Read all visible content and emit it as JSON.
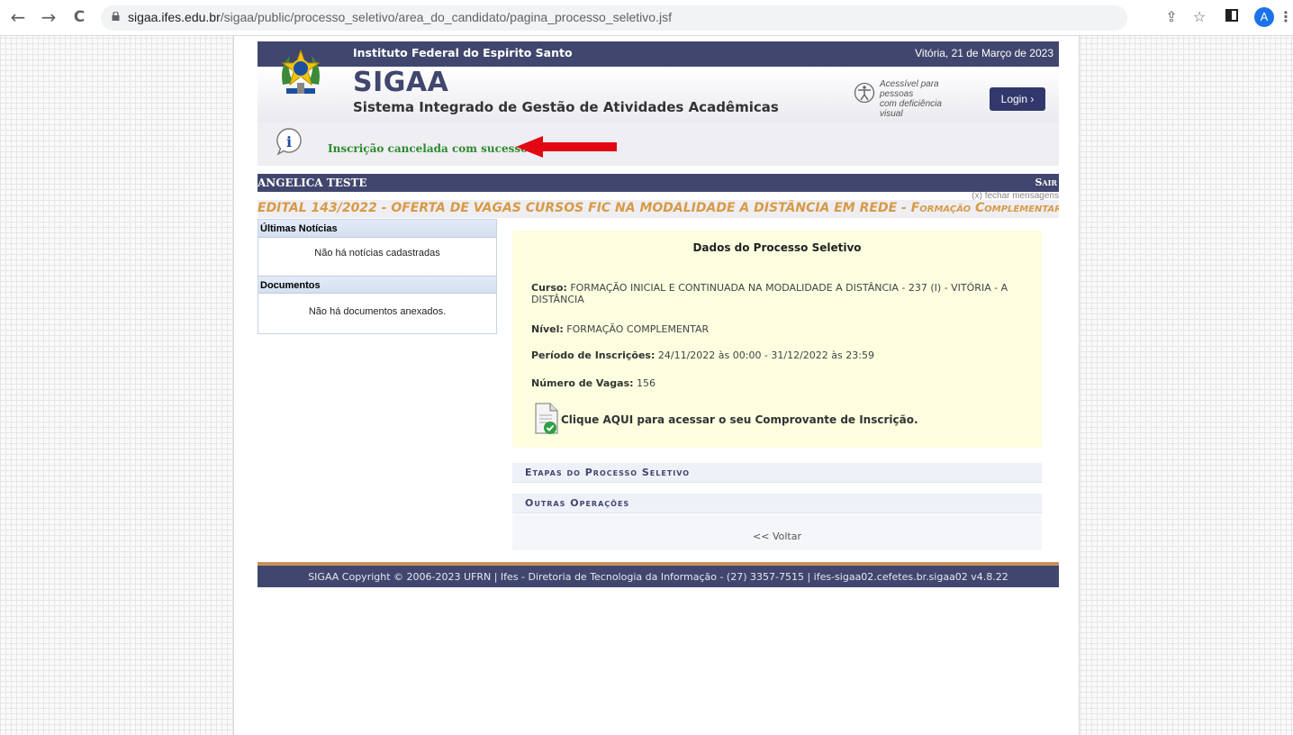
{
  "browser": {
    "back": "←",
    "forward": "→",
    "reload": "C",
    "url_host": "sigaa.ifes.edu.br",
    "url_path": "/sigaa/public/processo_seletivo/area_do_candidato/pagina_processo_seletivo.jsf",
    "profile_initial": "A"
  },
  "header": {
    "institution": "Instituto Federal do Espirito Santo",
    "date": "Vitória, 21 de Março de 2023",
    "system_name": "SIGAA",
    "system_full_name": "Sistema Integrado de Gestão de Atividades Acadêmicas",
    "accessibility_line1": "Acessível para pessoas",
    "accessibility_line2": "com deficiência visual",
    "login_label": "Login  ›"
  },
  "message": {
    "text": "Inscrição cancelada com sucesso.",
    "close_label": "(x) fechar mensagens"
  },
  "userbar": {
    "username": "ANGELICA TESTE",
    "logout": "Sair"
  },
  "edital": {
    "title": "EDITAL 143/2022 - OFERTA DE VAGAS CURSOS FIC NA MODALIDADE A DISTÂNCIA EM REDE - ",
    "subtitle": "Formação Complementar"
  },
  "sidebar": {
    "news_title": "Últimas Notícias",
    "news_empty": "Não há notícias cadastradas",
    "docs_title": "Documentos",
    "docs_empty": "Não há documentos anexados."
  },
  "processo": {
    "title": "Dados do Processo Seletivo",
    "curso_label": "Curso:",
    "curso_value": "FORMAÇÃO INICIAL E CONTINUADA NA MODALIDADE A DISTÂNCIA - 237 (I) - VITÓRIA - A DISTÂNCIA",
    "nivel_label": "Nível:",
    "nivel_value": "FORMAÇÃO COMPLEMENTAR",
    "periodo_label": "Período de Inscrições:",
    "periodo_value": "24/11/2022 às 00:00 - 31/12/2022 às 23:59",
    "vagas_label": "Número de Vagas:",
    "vagas_value": "156",
    "comprovante_link": "Clique AQUI para acessar o seu Comprovante de Inscrição."
  },
  "sections": {
    "etapas": "Etapas do Processo Seletivo",
    "outras": "Outras Operações"
  },
  "voltar": "<< Voltar",
  "footer": "SIGAA Copyright © 2006-2023 UFRN | Ifes - Diretoria de Tecnologia da Informação - (27) 3357-7515 | ifes-sigaa02.cefetes.br.sigaa02 v4.8.22",
  "colors": {
    "brand": "#41466e",
    "edital": "#d89a45",
    "success": "#2d8a2d",
    "panel_bg": "#fdfde0",
    "arrow": "#e30613"
  }
}
